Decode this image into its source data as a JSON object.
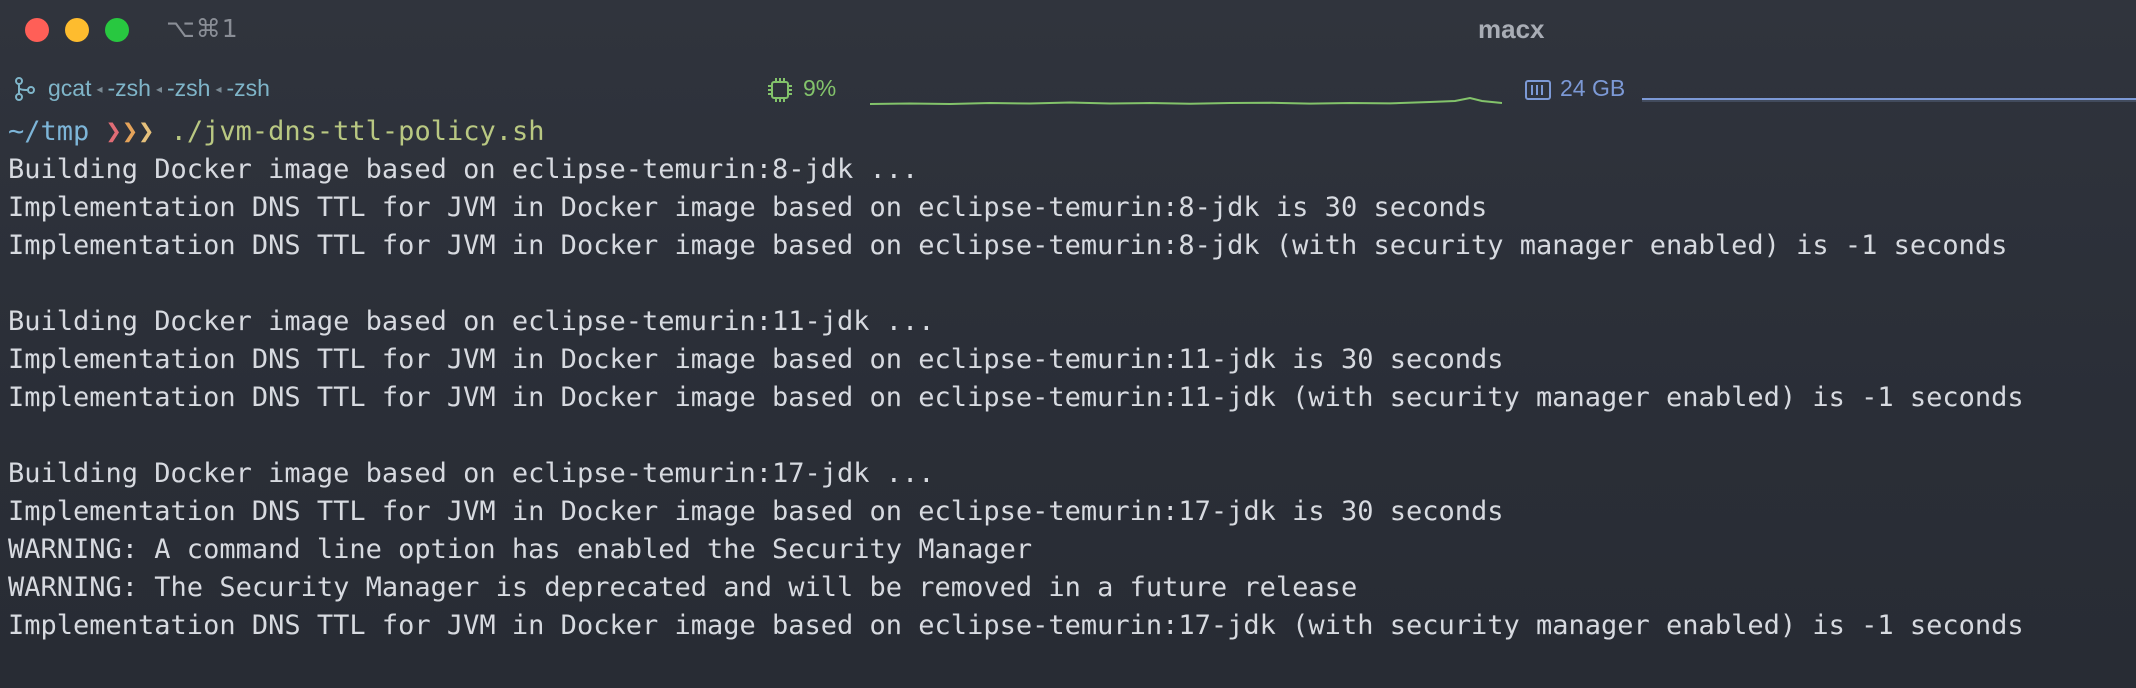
{
  "titlebar": {
    "close_glyph": "×",
    "minimize_glyph": "−",
    "zoom_glyph": "+",
    "tab_shortcut": "⌥⌘1",
    "title": "macx"
  },
  "statusbar": {
    "jobs": [
      "gcat",
      "-zsh",
      "-zsh",
      "-zsh"
    ],
    "job_separator": "◂",
    "cpu_value": "9%",
    "memory_value": "24 GB",
    "colors": {
      "jobs": "#7fb5c9",
      "cpu": "#83c36b",
      "memory": "#7c99d6"
    }
  },
  "terminal": {
    "prompt": {
      "directory": "~/tmp",
      "arrows": [
        "❯",
        "❯",
        "❯"
      ],
      "command": "./jvm-dns-ttl-policy.sh"
    },
    "output_lines": [
      "Building Docker image based on eclipse-temurin:8-jdk ...",
      "Implementation DNS TTL for JVM in Docker image based on eclipse-temurin:8-jdk is 30 seconds",
      "Implementation DNS TTL for JVM in Docker image based on eclipse-temurin:8-jdk (with security manager enabled) is -1 seconds",
      "",
      "Building Docker image based on eclipse-temurin:11-jdk ...",
      "Implementation DNS TTL for JVM in Docker image based on eclipse-temurin:11-jdk is 30 seconds",
      "Implementation DNS TTL for JVM in Docker image based on eclipse-temurin:11-jdk (with security manager enabled) is -1 seconds",
      "",
      "Building Docker image based on eclipse-temurin:17-jdk ...",
      "Implementation DNS TTL for JVM in Docker image based on eclipse-temurin:17-jdk is 30 seconds",
      "WARNING: A command line option has enabled the Security Manager",
      "WARNING: The Security Manager is deprecated and will be removed in a future release",
      "Implementation DNS TTL for JVM in Docker image based on eclipse-temurin:17-jdk (with security manager enabled) is -1 seconds"
    ]
  }
}
